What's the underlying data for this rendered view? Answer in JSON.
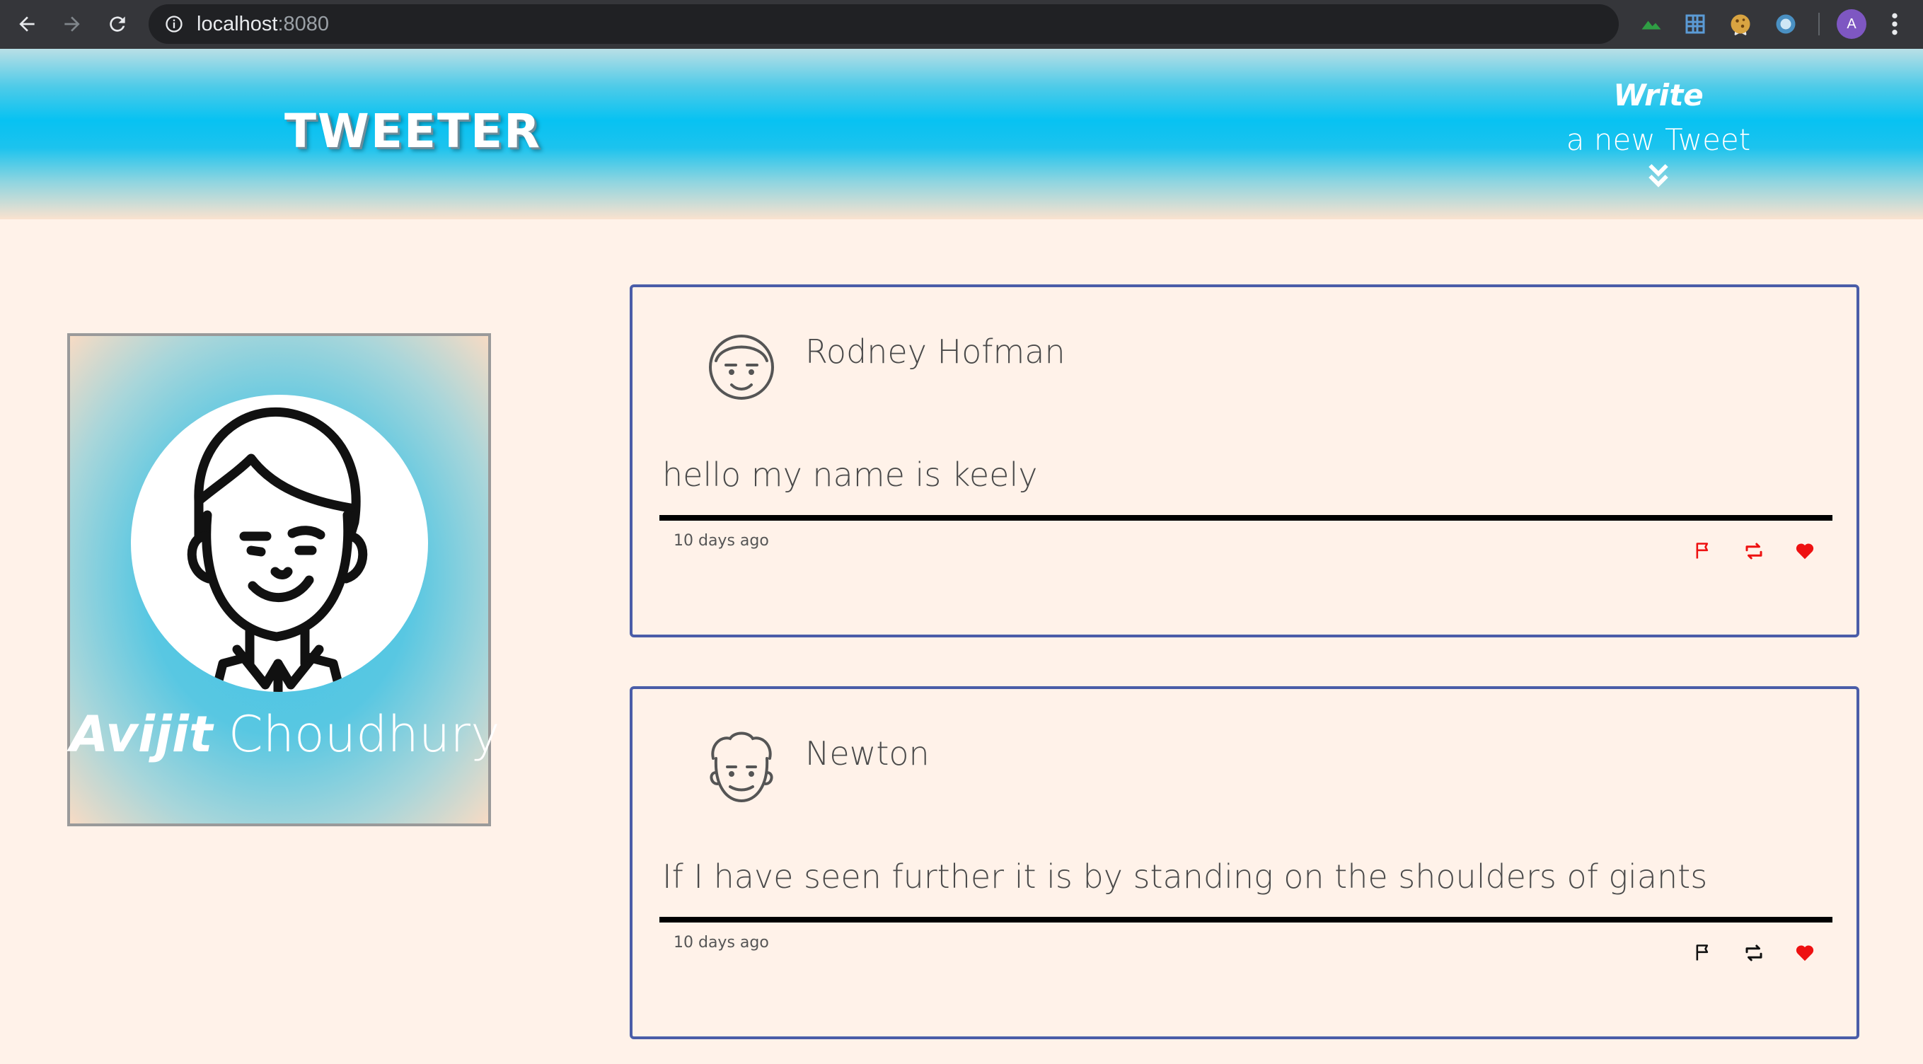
{
  "browser": {
    "url_host": "localhost",
    "url_port": ":8080",
    "profile_initial": "A"
  },
  "header": {
    "logo": "TWEETER",
    "write_label": "Write",
    "write_sub": "a new Tweet"
  },
  "profile": {
    "first_name": "Avijit",
    "last_name": "Choudhury"
  },
  "tweets": [
    {
      "author": "Rodney Hofman",
      "text": "hello my name is keely",
      "time": "10 days ago",
      "icon_color": "#ee1111"
    },
    {
      "author": "Newton",
      "text": "If I have seen further it is by standing on the shoulders of giants",
      "time": "10 days ago",
      "icon_color": "#111111"
    }
  ],
  "colors": {
    "page_bg": "#fff2e9",
    "tweet_border": "#4a5da8",
    "like": "#ee1111"
  }
}
